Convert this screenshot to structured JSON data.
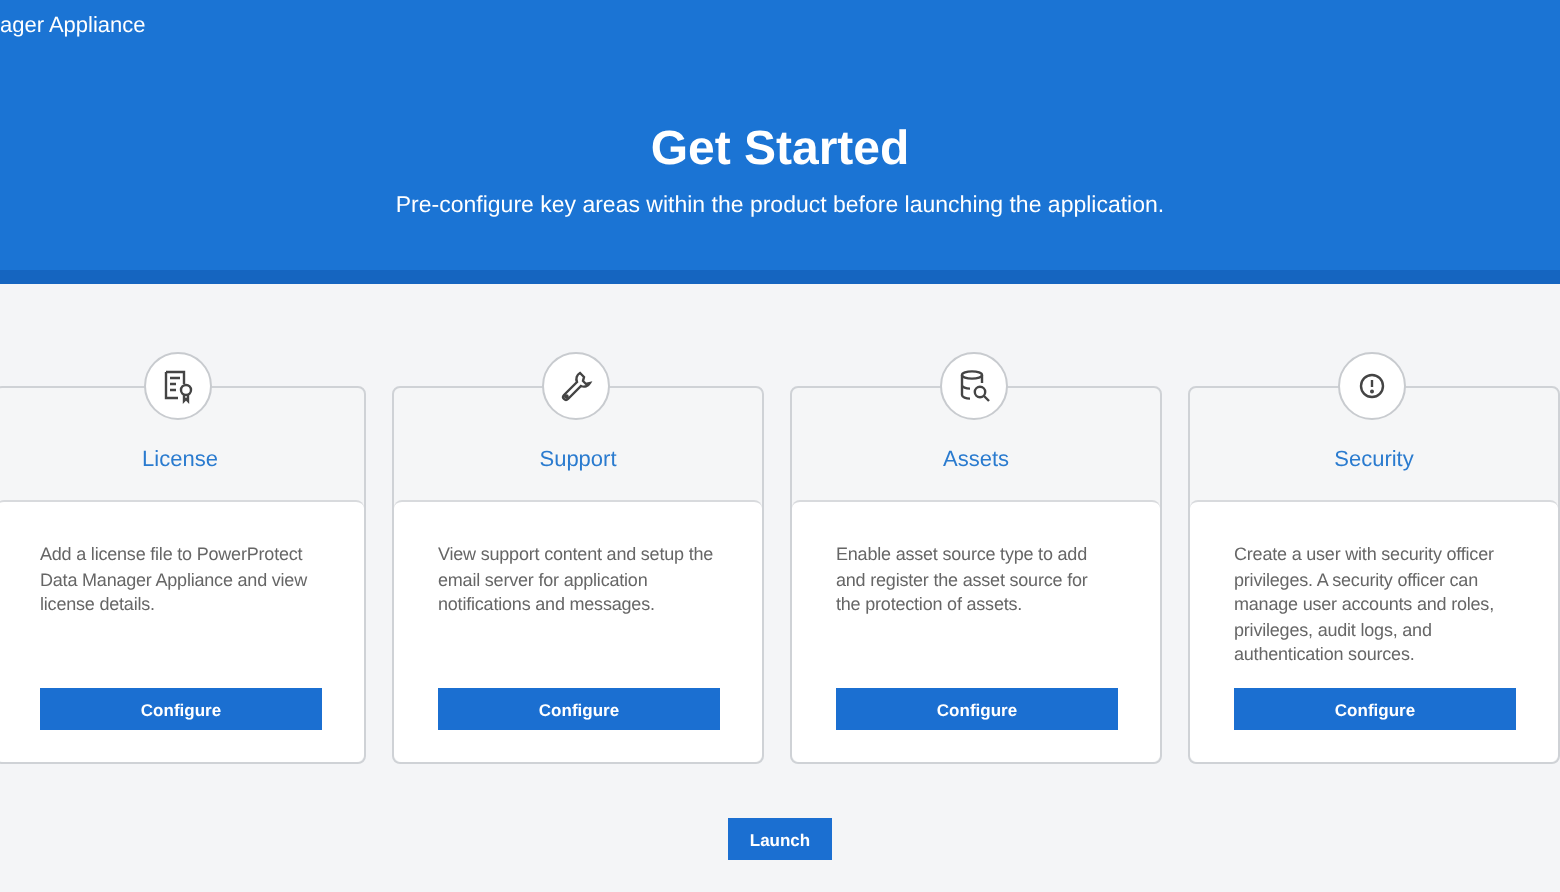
{
  "header": {
    "app_name": "ager Appliance",
    "title": "Get Started",
    "subtitle": "Pre-configure key areas within the product before launching the application."
  },
  "cards": [
    {
      "kind": "license",
      "title": "License",
      "description": "Add a license file to PowerProtect Data Manager Appliance and view license details.",
      "button": "Configure"
    },
    {
      "kind": "support",
      "title": "Support",
      "description": "View support content and setup the email server for application notifications and messages.",
      "button": "Configure"
    },
    {
      "kind": "assets",
      "title": "Assets",
      "description": "Enable asset source type to add and register the asset source for the protection of assets.",
      "button": "Configure"
    },
    {
      "kind": "security",
      "title": "Security",
      "description": "Create a user with security officer privileges. A security officer can manage user accounts and roles, privileges, audit logs, and authentication sources.",
      "button": "Configure"
    }
  ],
  "launch_button": "Launch"
}
